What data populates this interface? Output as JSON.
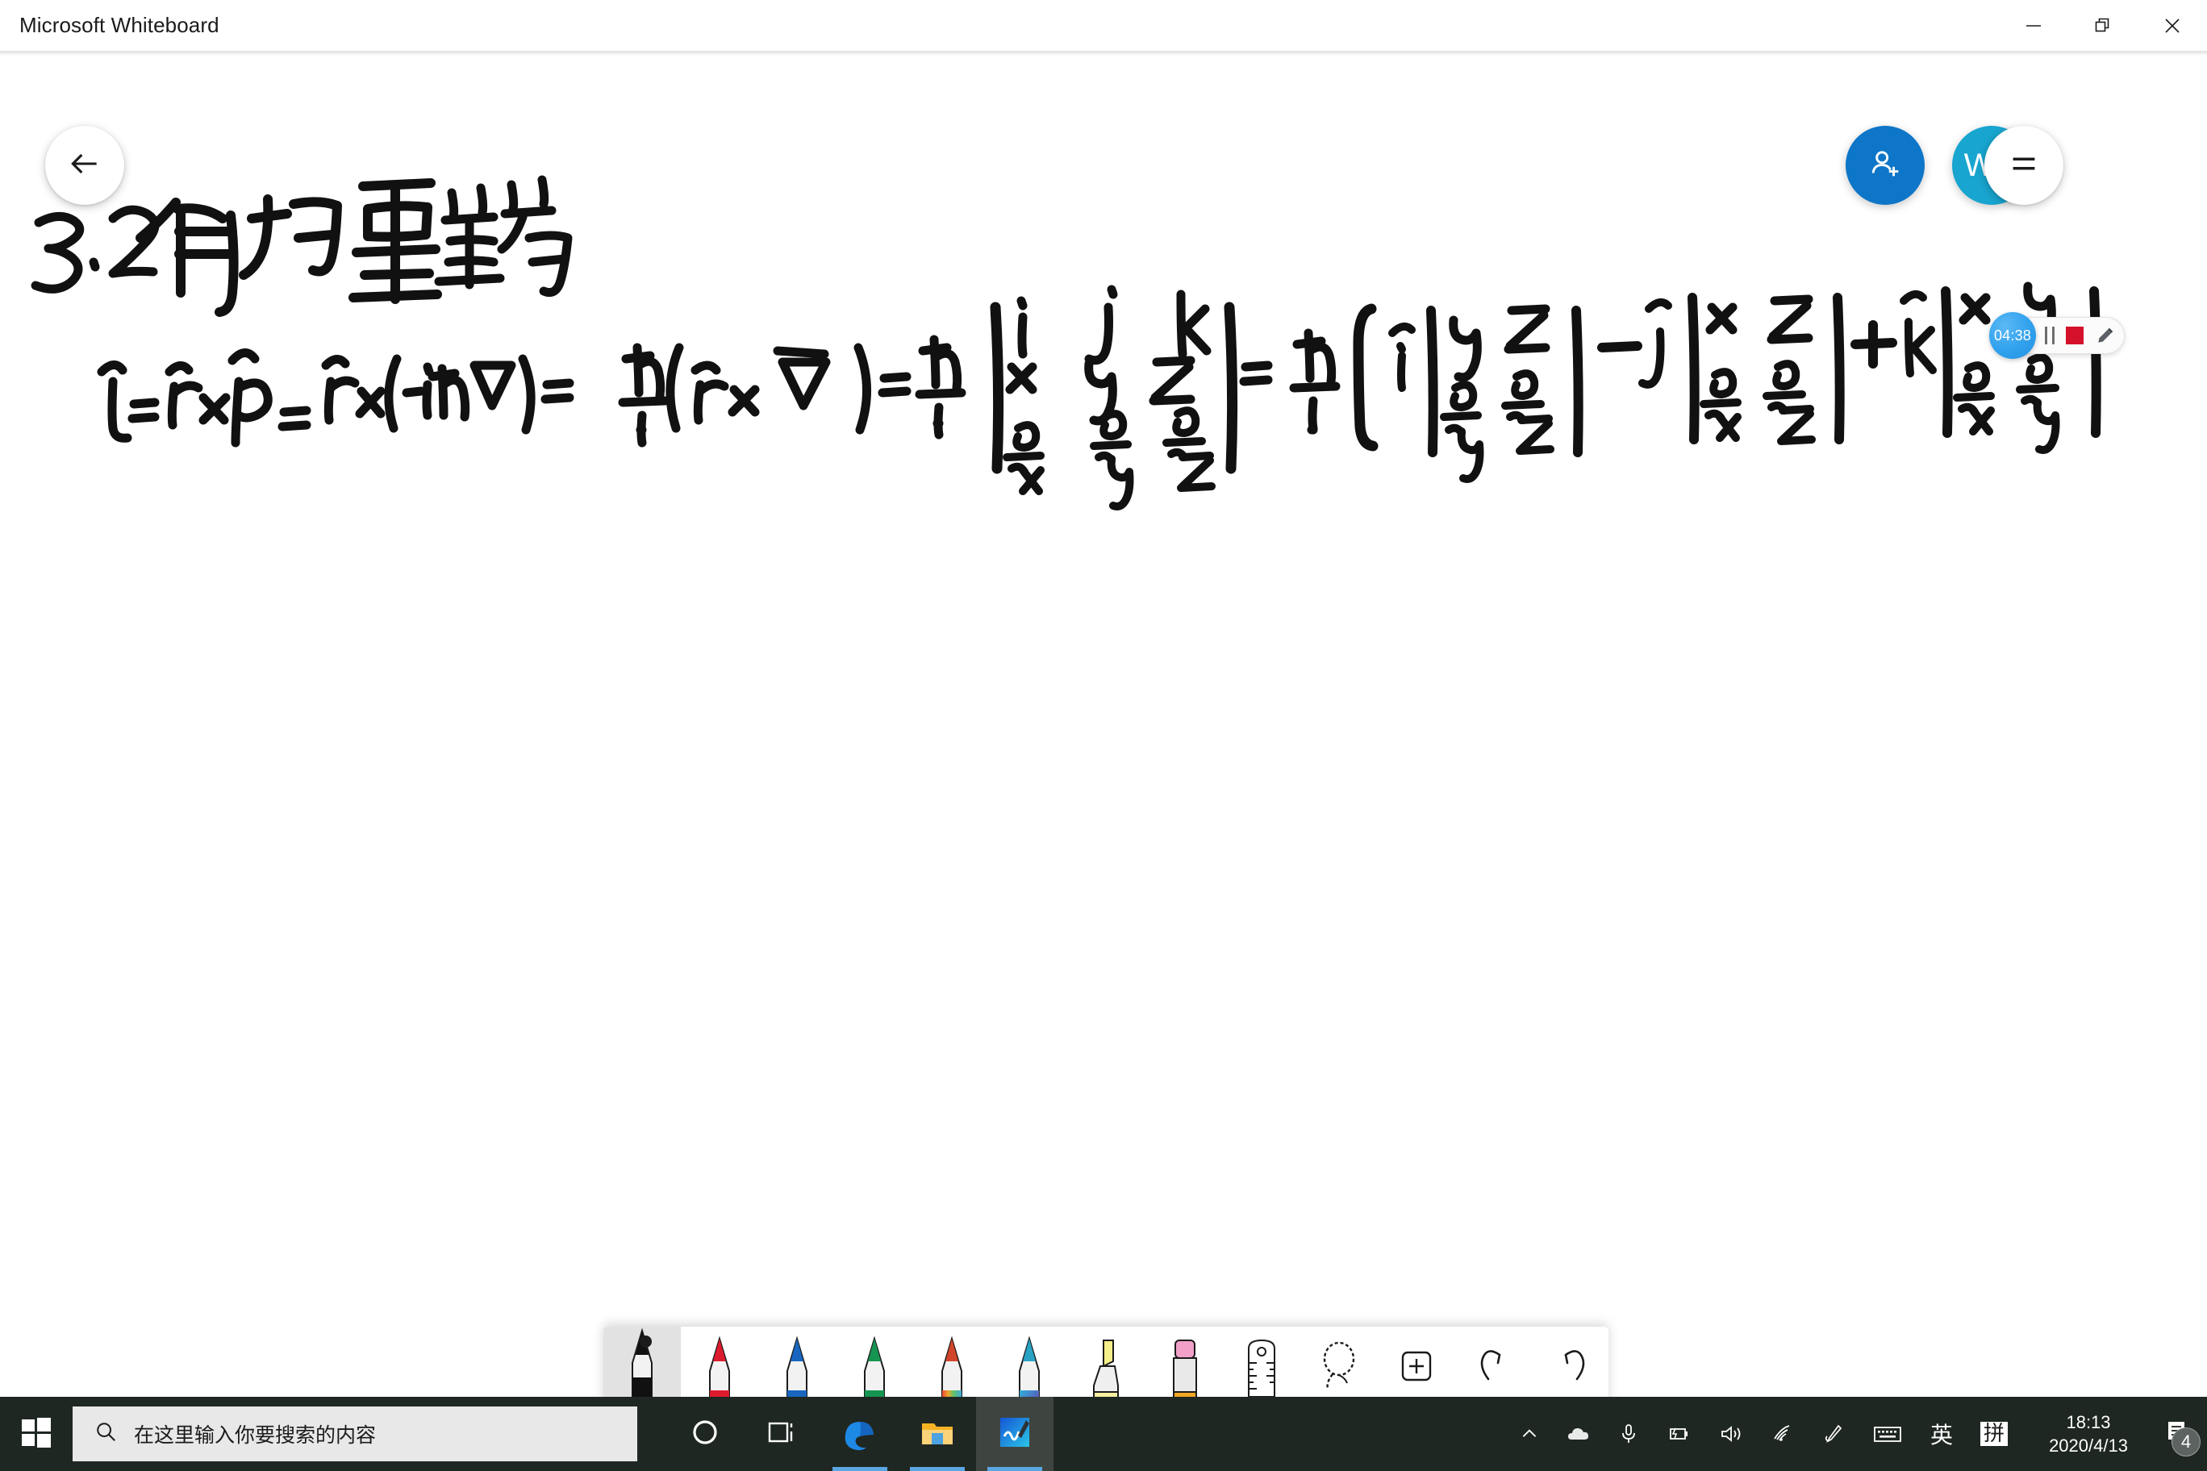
{
  "window": {
    "title": "Microsoft Whiteboard",
    "controls": [
      {
        "name": "minimize",
        "label": "—"
      },
      {
        "name": "restore",
        "label": "❐"
      },
      {
        "name": "close",
        "label": "✕"
      }
    ]
  },
  "canvas": {
    "back_button_icon": "back-arrow-icon",
    "share_button_icon": "add-person-icon",
    "avatar_initials": "WC",
    "menu_button_icon": "hamburger-menu-icon",
    "handwriting": {
      "title": "3.2 角动量算符",
      "line1": "L̂ = r̂ × p̂ = r̂ × (-iħ∇) = ħ/i (r⃗ × ∇⃗) = ħ/i | i j k ; x y z ; ∂/∂x ∂/∂y ∂/∂z |",
      "line2": "= ħ/i [ î |y z ; ∂/∂y ∂/∂z| - ĵ |x z ; ∂/∂x ∂/∂z| + k̂ |x y ; ∂/∂x ∂/∂y| ]"
    }
  },
  "recording_widget": {
    "timer": "04:38",
    "pause_label": "pause-recording",
    "stop_label": "stop-recording",
    "pencil_label": "annotate"
  },
  "toolbar": {
    "tools": [
      {
        "name": "pen-black",
        "label": "Black pen",
        "type": "pen",
        "color": "#111111",
        "selected": true
      },
      {
        "name": "pen-red",
        "label": "Red pen",
        "type": "pen",
        "color": "#dd1b2e",
        "selected": false
      },
      {
        "name": "pen-blue",
        "label": "Blue pen",
        "type": "pen",
        "color": "#1866c0",
        "selected": false
      },
      {
        "name": "pen-green",
        "label": "Green pen",
        "type": "pen",
        "color": "#169552",
        "selected": false
      },
      {
        "name": "pen-rainbow",
        "label": "Rainbow pen",
        "type": "pen-rainbow",
        "color": "#d1452a",
        "selected": false
      },
      {
        "name": "pen-galaxy",
        "label": "Galaxy pen",
        "type": "pen-galaxy",
        "color": "#29a3c4",
        "selected": false
      },
      {
        "name": "highlighter-yellow",
        "label": "Yellow highlighter",
        "type": "highlighter",
        "color": "#f7ef8a",
        "selected": false
      },
      {
        "name": "eraser",
        "label": "Eraser",
        "type": "eraser",
        "color": "#f2a0c8",
        "selected": false
      },
      {
        "name": "ruler",
        "label": "Ruler",
        "type": "icon",
        "icon": "ruler-icon",
        "selected": false
      },
      {
        "name": "lasso-select",
        "label": "Lasso select",
        "type": "icon",
        "icon": "lasso-icon",
        "selected": false
      },
      {
        "name": "insert",
        "label": "Insert",
        "type": "icon",
        "icon": "plus-square-icon",
        "selected": false
      },
      {
        "name": "undo",
        "label": "Undo",
        "type": "icon",
        "icon": "undo-icon",
        "selected": false
      },
      {
        "name": "redo",
        "label": "Redo",
        "type": "icon",
        "icon": "redo-icon",
        "selected": false
      }
    ]
  },
  "taskbar": {
    "start_label": "Start",
    "search_placeholder": "在这里输入你要搜索的内容",
    "apps": [
      {
        "name": "cortana",
        "label": "Cortana",
        "active": false,
        "underline": false
      },
      {
        "name": "task-view",
        "label": "Task View",
        "active": false,
        "underline": false
      },
      {
        "name": "microsoft-edge",
        "label": "Microsoft Edge",
        "active": false,
        "underline": true
      },
      {
        "name": "file-explorer",
        "label": "File Explorer",
        "active": false,
        "underline": true
      },
      {
        "name": "whiteboard",
        "label": "Microsoft Whiteboard",
        "active": true,
        "underline": true
      }
    ],
    "tray": [
      {
        "name": "show-hidden-icons",
        "label": "Show hidden icons"
      },
      {
        "name": "onedrive",
        "label": "OneDrive"
      },
      {
        "name": "microphone",
        "label": "Microphone"
      },
      {
        "name": "battery",
        "label": "Battery"
      },
      {
        "name": "volume",
        "label": "Volume"
      },
      {
        "name": "network",
        "label": "Network"
      },
      {
        "name": "pen-workspace",
        "label": "Windows Ink Workspace"
      },
      {
        "name": "touch-keyboard",
        "label": "Touch keyboard"
      }
    ],
    "ime_language": "英",
    "ime_mode": "拼",
    "time": "18:13",
    "date": "2020/4/13",
    "notification_count": "4"
  },
  "colors": {
    "accent_blue": "#0d76c8",
    "avatar_cyan": "#18a5cf",
    "taskbar": "#1f2722",
    "record_red": "#d4102a",
    "underline_blue": "#5aa7e4"
  }
}
